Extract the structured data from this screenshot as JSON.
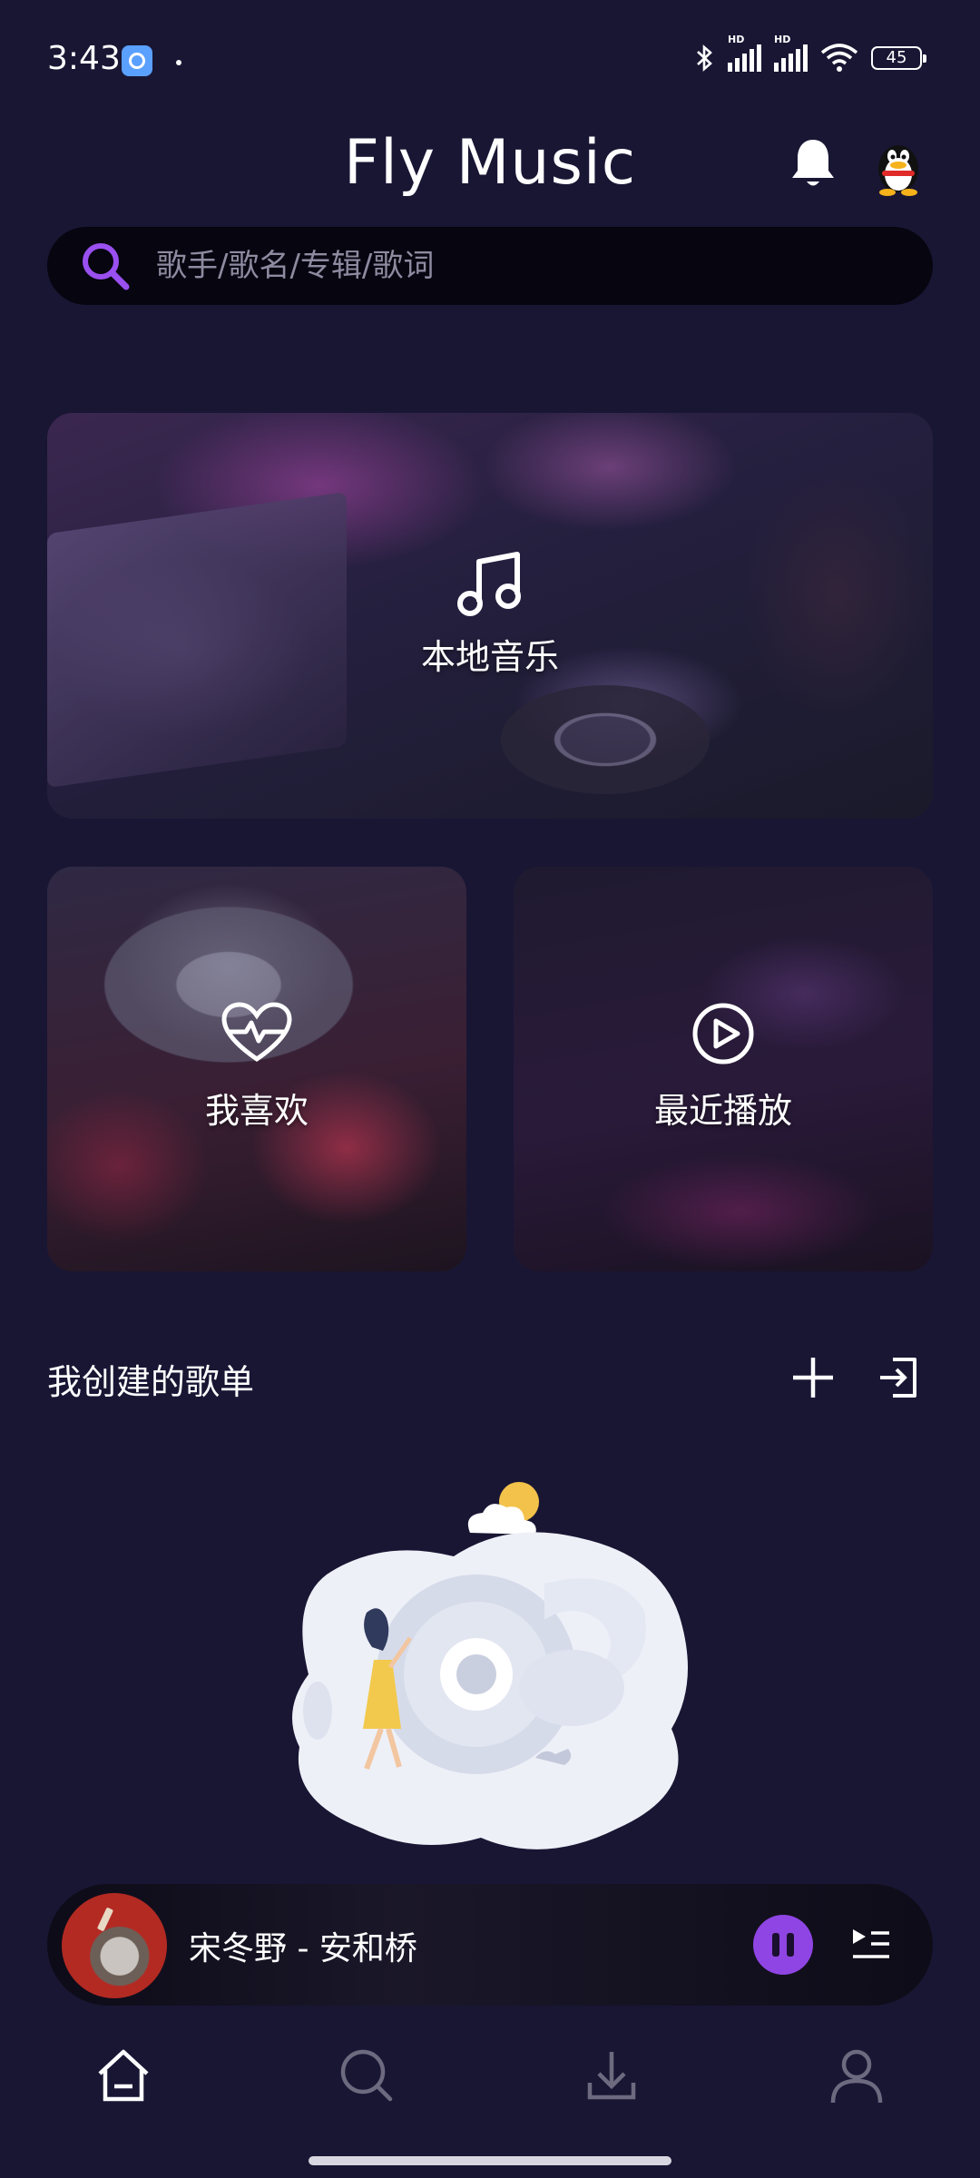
{
  "status_bar": {
    "time": "3:43",
    "battery": "45"
  },
  "header": {
    "title": "Fly Music"
  },
  "search": {
    "placeholder": "歌手/歌名/专辑/歌词"
  },
  "cards": {
    "local": "本地音乐",
    "like": "我喜欢",
    "recent": "最近播放"
  },
  "playlists": {
    "title": "我创建的歌单"
  },
  "player": {
    "song": "宋冬野 - 安和桥"
  },
  "colors": {
    "background": "#191634",
    "accent": "#8f45e3"
  },
  "icons": [
    "search-icon",
    "bell-icon",
    "qq-avatar-icon",
    "music-note-icon",
    "heart-pulse-icon",
    "play-circle-icon",
    "plus-icon",
    "import-icon",
    "pause-icon",
    "queue-icon",
    "home-icon",
    "discover-icon",
    "download-icon",
    "profile-icon"
  ]
}
